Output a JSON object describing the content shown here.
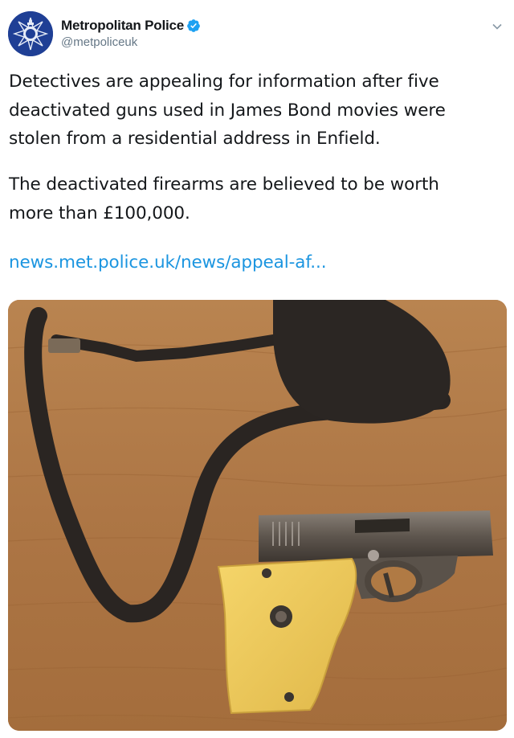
{
  "account": {
    "display_name": "Metropolitan Police",
    "handle": "@metpoliceuk",
    "verified": true,
    "avatar_icon": "police-crest-icon",
    "brand_color": "#1f3f95"
  },
  "tweet": {
    "paragraph_1_lines": [
      "Detectives are appealing for information after five",
      "deactivated guns used in James Bond movies were",
      "stolen from a residential address in Enfield."
    ],
    "paragraph_2_lines": [
      "The deactivated firearms are believed to be worth",
      "more than £100,000."
    ],
    "link_text": "news.met.police.uk/news/appeal-af...",
    "link_color": "#1b95e0"
  },
  "media": {
    "description_icon": "pistol-photo",
    "background_color": "#b07a44"
  },
  "menu": {
    "icon": "chevron-down-icon"
  }
}
